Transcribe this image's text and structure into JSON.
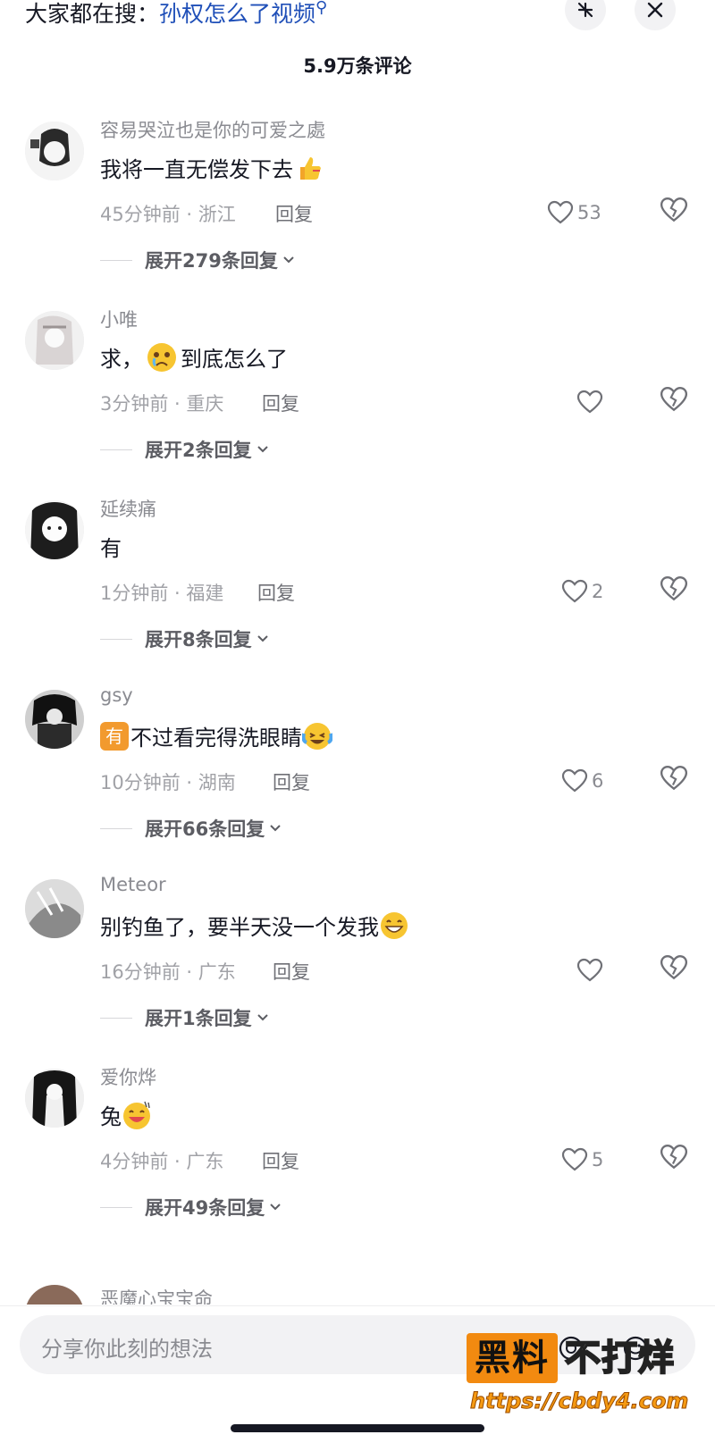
{
  "header": {
    "search_prefix": "大家都在搜：",
    "search_query": "孙权怎么了视频",
    "comment_count_title": "5.9万条评论"
  },
  "comments": [
    {
      "username": "容易哭泣也是你的可爱之處",
      "text": "我将一直无偿发下去",
      "emoji": "thumbs-up-emoji",
      "time_location": "45分钟前 · 浙江",
      "reply_label": "回复",
      "likes": "53",
      "expand_label": "展开279条回复"
    },
    {
      "username": "小唯",
      "text_before": "求，",
      "emoji": "crying-face-emoji",
      "text": "到底怎么了",
      "time_location": "3分钟前 · 重庆",
      "reply_label": "回复",
      "likes": "",
      "expand_label": "展开2条回复"
    },
    {
      "username": "延续痛",
      "text": "有",
      "time_location": "1分钟前 · 福建",
      "reply_label": "回复",
      "likes": "2",
      "expand_label": "展开8条回复"
    },
    {
      "username": "gsy",
      "badge": "有",
      "text": "不过看完得洗眼睛",
      "emoji": "laughing-tears-emoji",
      "time_location": "10分钟前 · 湖南",
      "reply_label": "回复",
      "likes": "6",
      "expand_label": "展开66条回复"
    },
    {
      "username": "Meteor",
      "text": "别钓鱼了，要半天没一个发我",
      "emoji": "grinning-face-emoji",
      "time_location": "16分钟前 · 广东",
      "reply_label": "回复",
      "likes": "",
      "expand_label": "展开1条回复"
    },
    {
      "username": "爱你烨",
      "text": "兔",
      "emoji": "sweat-grin-emoji",
      "time_location": "4分钟前 · 广东",
      "reply_label": "回复",
      "likes": "5",
      "expand_label": "展开49条回复"
    }
  ],
  "partial_next_username": "恶魔心宝宝命",
  "input": {
    "placeholder": "分享你此刻的想法"
  },
  "watermark": {
    "box_text": "黑料",
    "text": "不打烊",
    "url": "https://cbdy4.com"
  },
  "colors": {
    "accent_link": "#1f4fb8",
    "watermark_orange": "#f28a10",
    "muted_text": "#8a8b91"
  }
}
